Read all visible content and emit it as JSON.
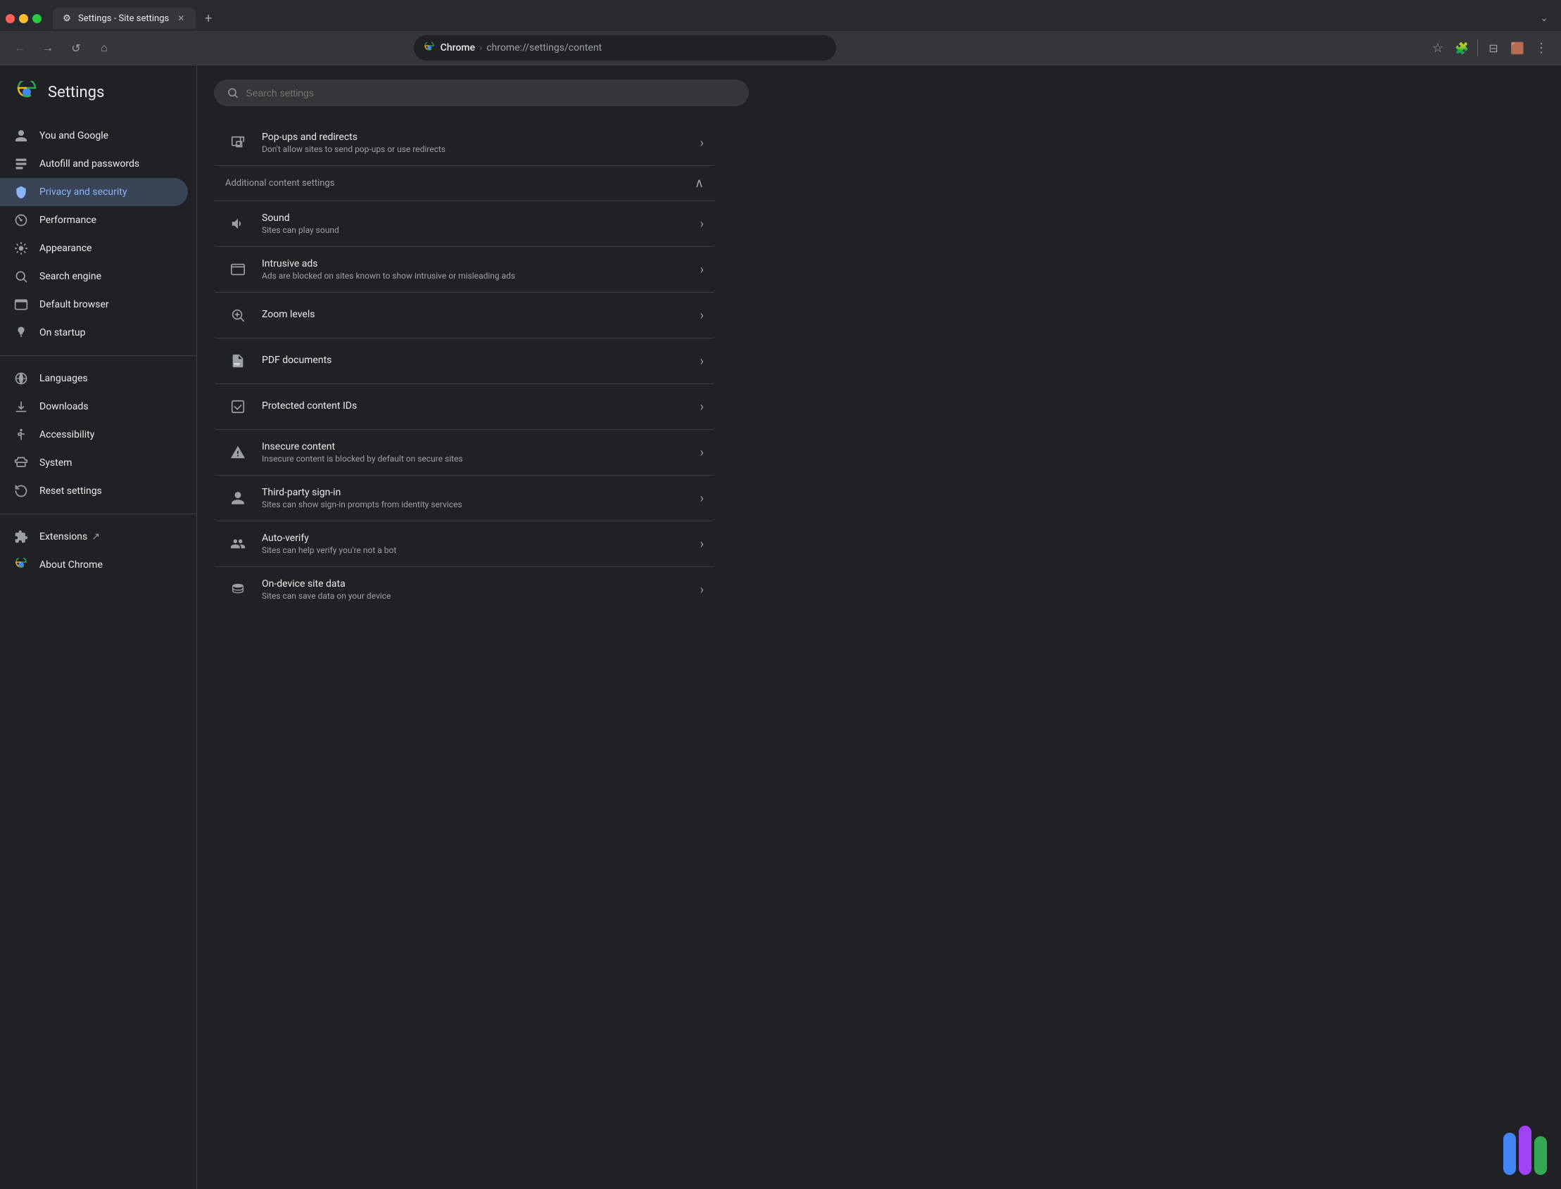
{
  "browser": {
    "tab_title": "Settings - Site settings",
    "tab_favicon": "⚙",
    "url_brand": "Chrome",
    "url_path": "chrome://settings/content",
    "new_tab_label": "+"
  },
  "sidebar": {
    "logo_label": "Chrome settings logo",
    "title": "Settings",
    "search_placeholder": "Search settings",
    "nav_items": [
      {
        "id": "you-and-google",
        "label": "You and Google",
        "icon": "👤"
      },
      {
        "id": "autofill-passwords",
        "label": "Autofill and passwords",
        "icon": "📋"
      },
      {
        "id": "privacy-security",
        "label": "Privacy and security",
        "icon": "🛡",
        "active": true
      },
      {
        "id": "performance",
        "label": "Performance",
        "icon": "📊"
      },
      {
        "id": "appearance",
        "label": "Appearance",
        "icon": "🎨"
      },
      {
        "id": "search-engine",
        "label": "Search engine",
        "icon": "🔍"
      },
      {
        "id": "default-browser",
        "label": "Default browser",
        "icon": "🖥"
      },
      {
        "id": "on-startup",
        "label": "On startup",
        "icon": "⏻"
      }
    ],
    "nav_items_secondary": [
      {
        "id": "languages",
        "label": "Languages",
        "icon": "🌐"
      },
      {
        "id": "downloads",
        "label": "Downloads",
        "icon": "⬇"
      },
      {
        "id": "accessibility",
        "label": "Accessibility",
        "icon": "♿"
      },
      {
        "id": "system",
        "label": "System",
        "icon": "🔧"
      },
      {
        "id": "reset-settings",
        "label": "Reset settings",
        "icon": "🕐"
      }
    ],
    "nav_items_tertiary": [
      {
        "id": "extensions",
        "label": "Extensions",
        "icon": "🧩",
        "has_external": true
      },
      {
        "id": "about-chrome",
        "label": "About Chrome",
        "icon": "⚙"
      }
    ]
  },
  "content": {
    "items": [
      {
        "id": "popups-redirects",
        "icon": "⧉",
        "title": "Pop-ups and redirects",
        "description": "Don't allow sites to send pop-ups or use redirects"
      }
    ],
    "section": {
      "label": "Additional content settings",
      "expanded": true
    },
    "additional_items": [
      {
        "id": "sound",
        "icon": "🔊",
        "title": "Sound",
        "description": "Sites can play sound"
      },
      {
        "id": "intrusive-ads",
        "icon": "🖥",
        "title": "Intrusive ads",
        "description": "Ads are blocked on sites known to show intrusive or misleading ads"
      },
      {
        "id": "zoom-levels",
        "icon": "🔍",
        "title": "Zoom levels",
        "description": ""
      },
      {
        "id": "pdf-documents",
        "icon": "📄",
        "title": "PDF documents",
        "description": ""
      },
      {
        "id": "protected-content",
        "icon": "☑",
        "title": "Protected content IDs",
        "description": ""
      },
      {
        "id": "insecure-content",
        "icon": "⚠",
        "title": "Insecure content",
        "description": "Insecure content is blocked by default on secure sites"
      },
      {
        "id": "third-party-signin",
        "icon": "👤",
        "title": "Third-party sign-in",
        "description": "Sites can show sign-in prompts from identity services"
      },
      {
        "id": "auto-verify",
        "icon": "👥",
        "title": "Auto-verify",
        "description": "Sites can help verify you're not a bot"
      },
      {
        "id": "on-device-data",
        "icon": "💾",
        "title": "On-device site data",
        "description": "Sites can save data on your device"
      }
    ]
  },
  "colors": {
    "active_nav_bg": "#394457",
    "active_nav_text": "#8ab4f8",
    "bar1": "#4285f4",
    "bar2": "#a142f4",
    "bar3": "#34a853"
  }
}
